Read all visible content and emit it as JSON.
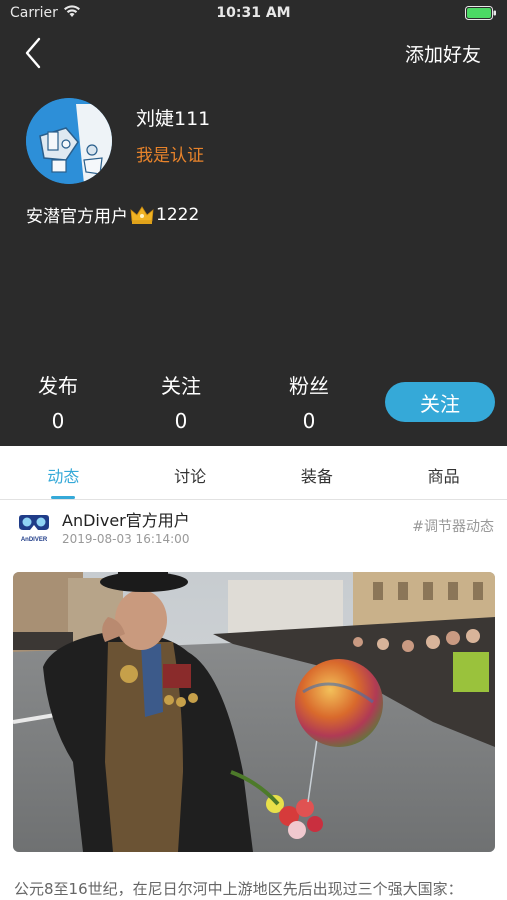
{
  "status_bar": {
    "carrier": "Carrier",
    "time": "10:31 AM",
    "icons": [
      "wifi-icon",
      "battery-icon"
    ]
  },
  "nav": {
    "back_icon": "chevron-left-icon",
    "add_friend": "添加好友"
  },
  "profile": {
    "name": "刘婕111",
    "verify": "我是认证",
    "role": "安潜官方用户",
    "level_icon": "crown-icon",
    "level": "1222"
  },
  "stats": [
    {
      "label": "发布",
      "value": "0"
    },
    {
      "label": "关注",
      "value": "0"
    },
    {
      "label": "粉丝",
      "value": "0"
    }
  ],
  "follow_button": "关注",
  "tabs": [
    {
      "label": "动态",
      "active": true
    },
    {
      "label": "讨论",
      "active": false
    },
    {
      "label": "装备",
      "active": false
    },
    {
      "label": "商品",
      "active": false
    }
  ],
  "post": {
    "author": "AnDiver官方用户",
    "avatar_text": "AnDIVER",
    "time": "2019-08-03 16:14:00",
    "tag": "#调节器动态",
    "text": "公元8至16世纪，在尼日尔河中上游地区先后出现过三个强大国家："
  },
  "colors": {
    "header_bg": "#2b2b2b",
    "accent": "#35a9d8",
    "verify": "#e7832b"
  }
}
